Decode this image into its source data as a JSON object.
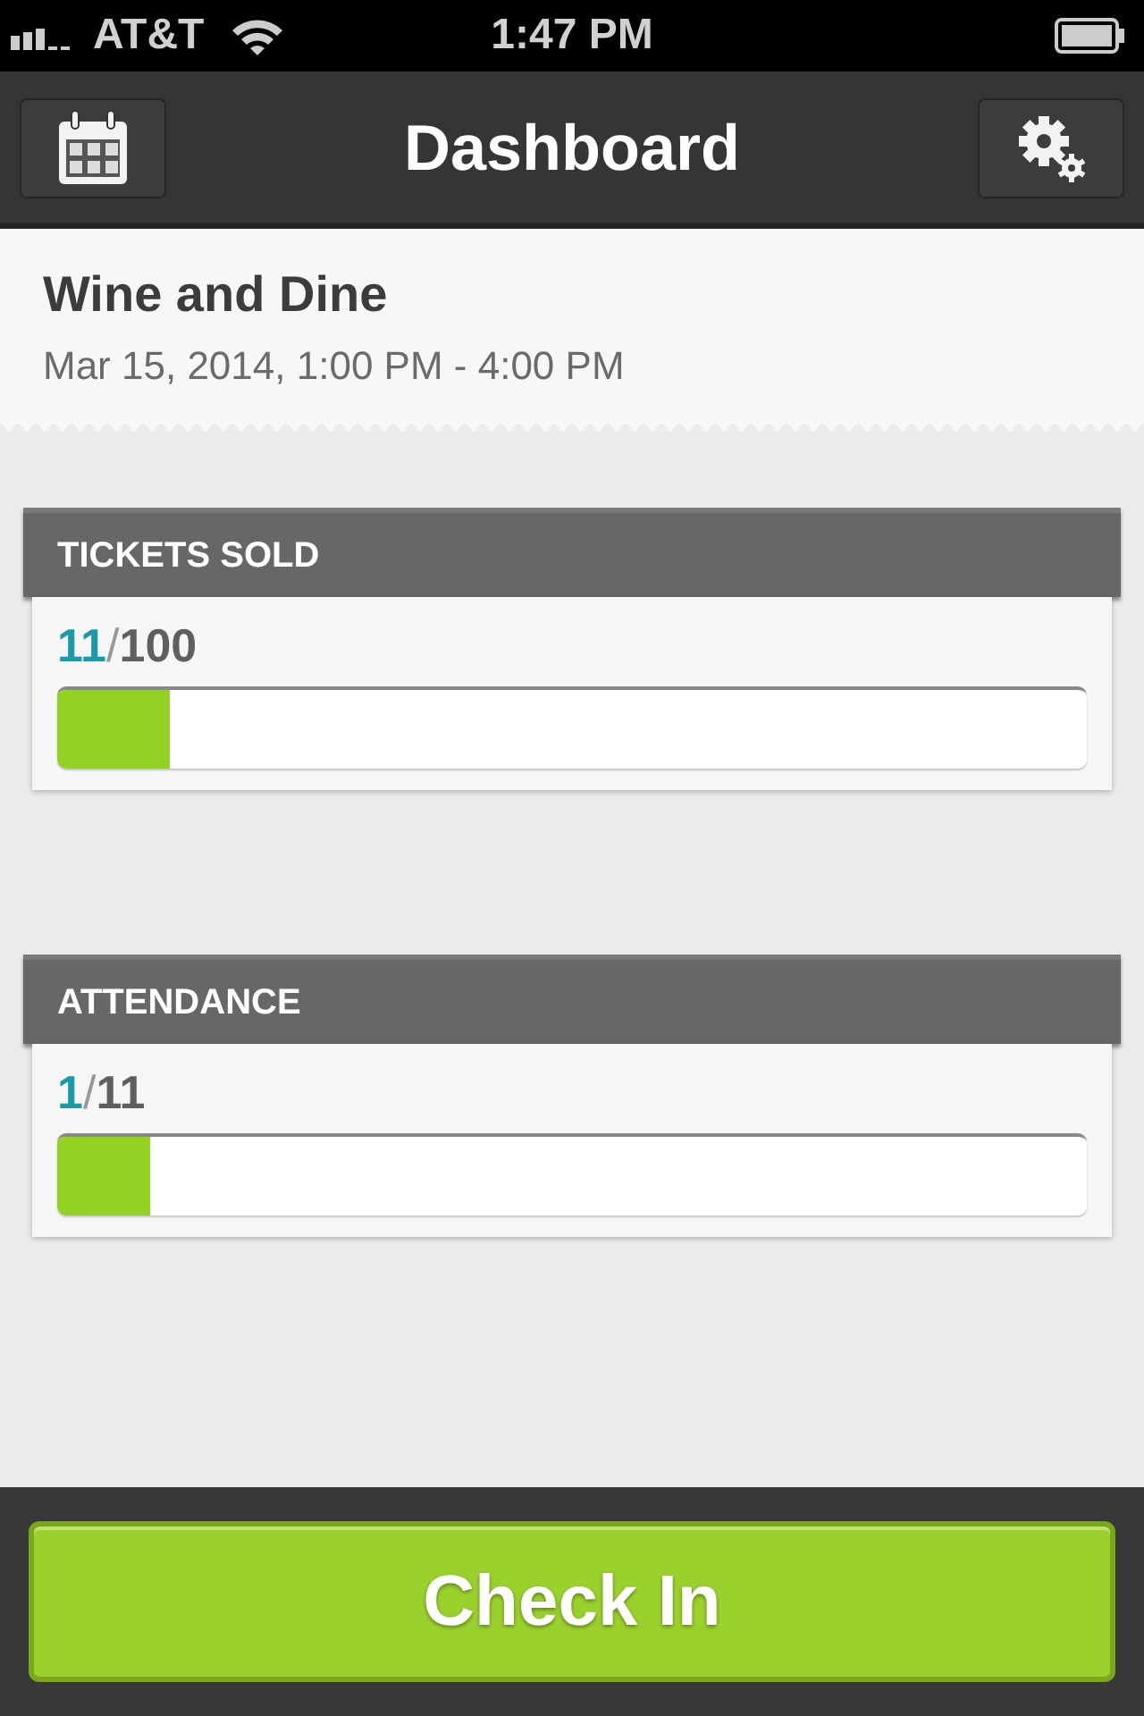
{
  "status_bar": {
    "carrier": "AT&T",
    "time": "1:47 PM"
  },
  "nav_bar": {
    "title": "Dashboard"
  },
  "event": {
    "name": "Wine and Dine",
    "when": "Mar 15, 2014, 1:00 PM - 4:00 PM"
  },
  "stats": [
    {
      "title": "TICKETS SOLD",
      "count": "11",
      "separator": "/",
      "total": "100",
      "level": 0.11
    },
    {
      "title": "ATTENDANCE",
      "count": "1",
      "separator": "/",
      "total": "11",
      "level": 0.09
    }
  ],
  "action_button": "Check In"
}
